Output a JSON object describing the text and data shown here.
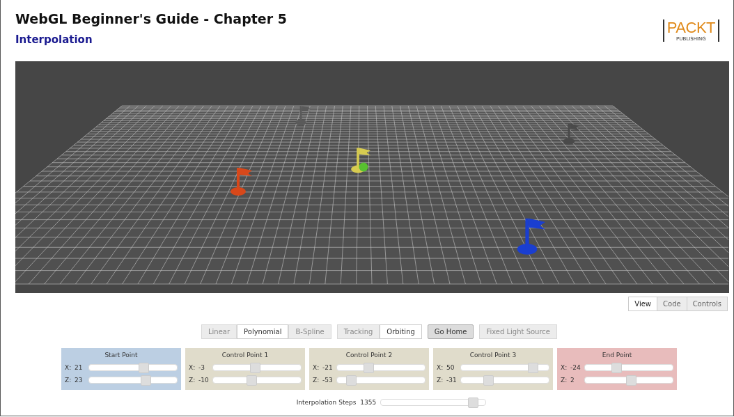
{
  "header": {
    "title": "WebGL Beginner's Guide - Chapter 5",
    "subtitle": "Interpolation",
    "logo": {
      "word": "PACKT",
      "tagline": "PUBLISHING"
    }
  },
  "scene": {
    "flags": [
      {
        "color": "#5a5a5a"
      },
      {
        "color": "#4a4a4a"
      },
      {
        "color": "#d8cc50"
      },
      {
        "color": "#d8481a"
      },
      {
        "color": "#1a3ed0"
      }
    ],
    "ball": {
      "color": "#58c030"
    }
  },
  "view_tabs": [
    {
      "label": "View",
      "selected": true
    },
    {
      "label": "Code",
      "selected": false
    },
    {
      "label": "Controls",
      "selected": false
    }
  ],
  "button_groups": [
    {
      "kind": "toggle",
      "buttons": [
        {
          "label": "Linear",
          "selected": false
        },
        {
          "label": "Polynomial",
          "selected": true
        },
        {
          "label": "B-Spline",
          "selected": false
        }
      ]
    },
    {
      "kind": "toggle",
      "buttons": [
        {
          "label": "Tracking",
          "selected": false
        },
        {
          "label": "Orbiting",
          "selected": true
        }
      ]
    },
    {
      "kind": "action",
      "buttons": [
        {
          "label": "Go Home",
          "selected": true
        }
      ]
    },
    {
      "kind": "action",
      "buttons": [
        {
          "label": "Fixed Light Source",
          "selected": false
        }
      ]
    }
  ],
  "panels": [
    {
      "kind": "start",
      "title": "Start Point",
      "sliders": [
        {
          "axis": "X:",
          "value": "21",
          "level": 0.62
        },
        {
          "axis": "Z:",
          "value": "23",
          "level": 0.64
        }
      ]
    },
    {
      "kind": "control",
      "title": "Control Point 1",
      "sliders": [
        {
          "axis": "X:",
          "value": "-3",
          "level": 0.48
        },
        {
          "axis": "Z:",
          "value": "-10",
          "level": 0.44
        }
      ]
    },
    {
      "kind": "control",
      "title": "Control Point 2",
      "sliders": [
        {
          "axis": "X:",
          "value": "-21",
          "level": 0.36
        },
        {
          "axis": "Z:",
          "value": "-53",
          "level": 0.16
        }
      ]
    },
    {
      "kind": "control",
      "title": "Control Point 3",
      "sliders": [
        {
          "axis": "X:",
          "value": "50",
          "level": 0.82
        },
        {
          "axis": "Z:",
          "value": "-31",
          "level": 0.31
        }
      ]
    },
    {
      "kind": "end",
      "title": "End Point",
      "sliders": [
        {
          "axis": "X:",
          "value": "-24",
          "level": 0.36
        },
        {
          "axis": "Z:",
          "value": "2",
          "level": 0.52
        }
      ]
    }
  ],
  "steps": {
    "label": "Interpolation Steps",
    "value": "1355",
    "level": 0.88
  }
}
